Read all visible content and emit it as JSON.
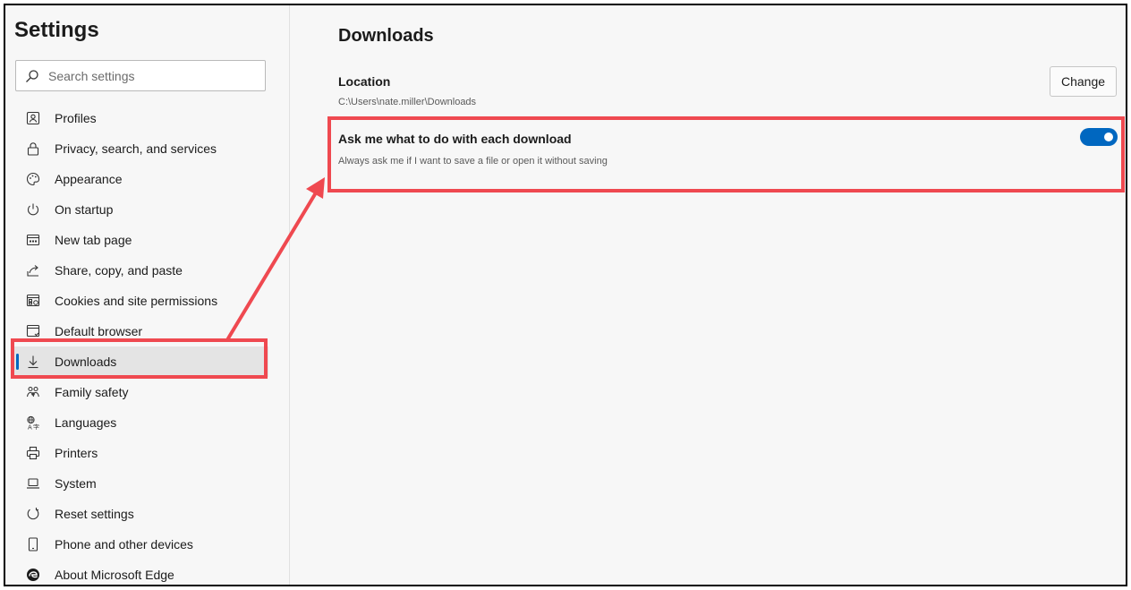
{
  "sidebar": {
    "title": "Settings",
    "search_placeholder": "Search settings",
    "items": [
      {
        "label": "Profiles",
        "icon": "profile-icon"
      },
      {
        "label": "Privacy, search, and services",
        "icon": "lock-icon"
      },
      {
        "label": "Appearance",
        "icon": "palette-icon"
      },
      {
        "label": "On startup",
        "icon": "power-icon"
      },
      {
        "label": "New tab page",
        "icon": "new-tab-icon"
      },
      {
        "label": "Share, copy, and paste",
        "icon": "share-icon"
      },
      {
        "label": "Cookies and site permissions",
        "icon": "cookies-icon"
      },
      {
        "label": "Default browser",
        "icon": "browser-icon"
      },
      {
        "label": "Downloads",
        "icon": "download-icon",
        "active": true
      },
      {
        "label": "Family safety",
        "icon": "family-icon"
      },
      {
        "label": "Languages",
        "icon": "languages-icon"
      },
      {
        "label": "Printers",
        "icon": "printer-icon"
      },
      {
        "label": "System",
        "icon": "laptop-icon"
      },
      {
        "label": "Reset settings",
        "icon": "reset-icon"
      },
      {
        "label": "Phone and other devices",
        "icon": "phone-icon"
      },
      {
        "label": "About Microsoft Edge",
        "icon": "edge-logo-icon"
      }
    ]
  },
  "main": {
    "title": "Downloads",
    "location": {
      "label": "Location",
      "path": "C:\\Users\\nate.miller\\Downloads",
      "change_label": "Change"
    },
    "ask_setting": {
      "label": "Ask me what to do with each download",
      "description": "Always ask me if I want to save a file or open it without saving",
      "enabled": true
    }
  },
  "colors": {
    "accent": "#0067c0",
    "callout": "#ef4950",
    "background": "#f7f7f7"
  }
}
